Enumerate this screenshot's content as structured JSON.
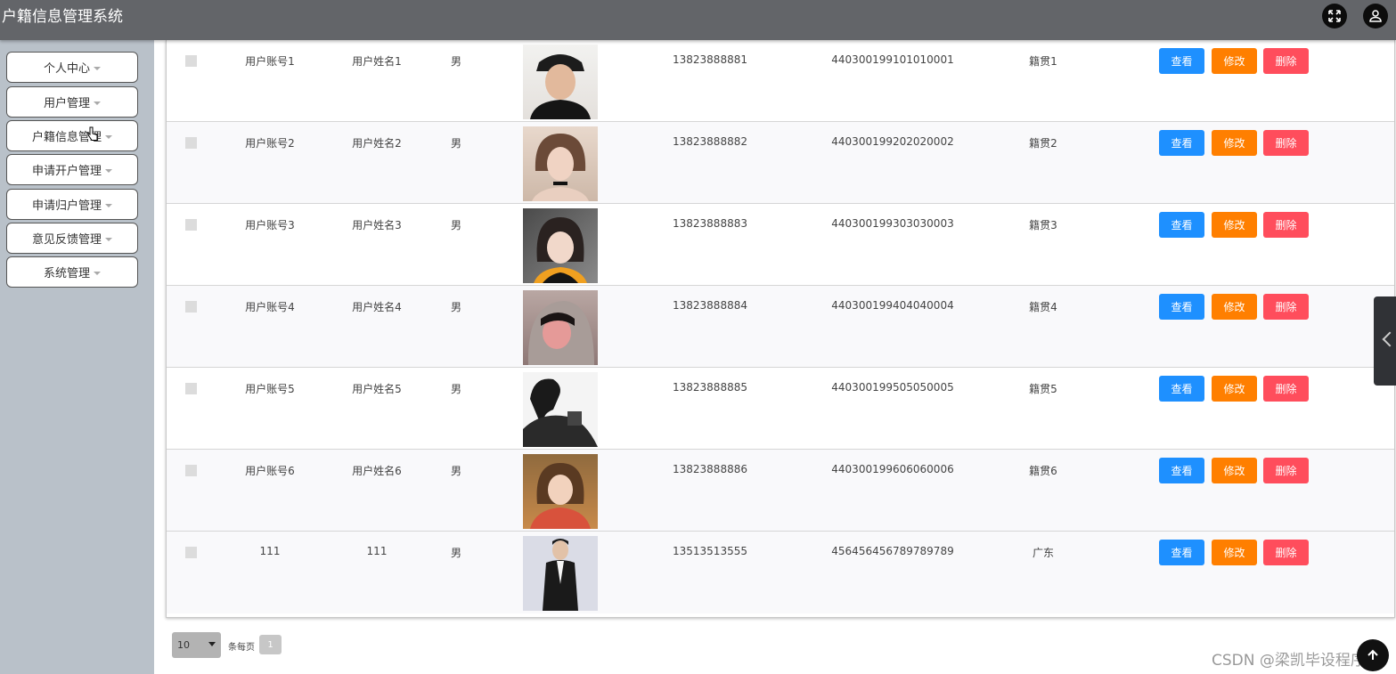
{
  "header": {
    "title": "户籍信息管理系统",
    "icons": [
      "fullscreen-icon",
      "user-icon"
    ]
  },
  "sidebar": {
    "items": [
      {
        "label": "个人中心"
      },
      {
        "label": "用户管理"
      },
      {
        "label": "户籍信息管理"
      },
      {
        "label": "申请开户管理"
      },
      {
        "label": "申请归户管理"
      },
      {
        "label": "意见反馈管理"
      },
      {
        "label": "系统管理"
      }
    ]
  },
  "actions": {
    "view": "查看",
    "edit": "修改",
    "delete": "删除"
  },
  "table": {
    "rows": [
      {
        "account": "用户账号1",
        "name": "用户姓名1",
        "gender": "男",
        "phone": "13823888881",
        "id_number": "440300199101010001",
        "origin": "籍贯1"
      },
      {
        "account": "用户账号2",
        "name": "用户姓名2",
        "gender": "男",
        "phone": "13823888882",
        "id_number": "440300199202020002",
        "origin": "籍贯2"
      },
      {
        "account": "用户账号3",
        "name": "用户姓名3",
        "gender": "男",
        "phone": "13823888883",
        "id_number": "440300199303030003",
        "origin": "籍贯3"
      },
      {
        "account": "用户账号4",
        "name": "用户姓名4",
        "gender": "男",
        "phone": "13823888884",
        "id_number": "440300199404040004",
        "origin": "籍贯4"
      },
      {
        "account": "用户账号5",
        "name": "用户姓名5",
        "gender": "男",
        "phone": "13823888885",
        "id_number": "440300199505050005",
        "origin": "籍贯5"
      },
      {
        "account": "用户账号6",
        "name": "用户姓名6",
        "gender": "男",
        "phone": "13823888886",
        "id_number": "440300199606060006",
        "origin": "籍贯6"
      },
      {
        "account": "111",
        "name": "111",
        "gender": "男",
        "phone": "13513513555",
        "id_number": "456456456789789789",
        "origin": "广东"
      }
    ]
  },
  "pagination": {
    "page_size": "10",
    "per_page_label": "条每页",
    "current_page": "1"
  },
  "watermark": "CSDN @梁凯毕设程序",
  "colors": {
    "header": "#636569",
    "sidebar": "#b9c1c9",
    "view": "#1e90ff",
    "edit": "#ff7f00",
    "delete": "#ff4d5c"
  }
}
